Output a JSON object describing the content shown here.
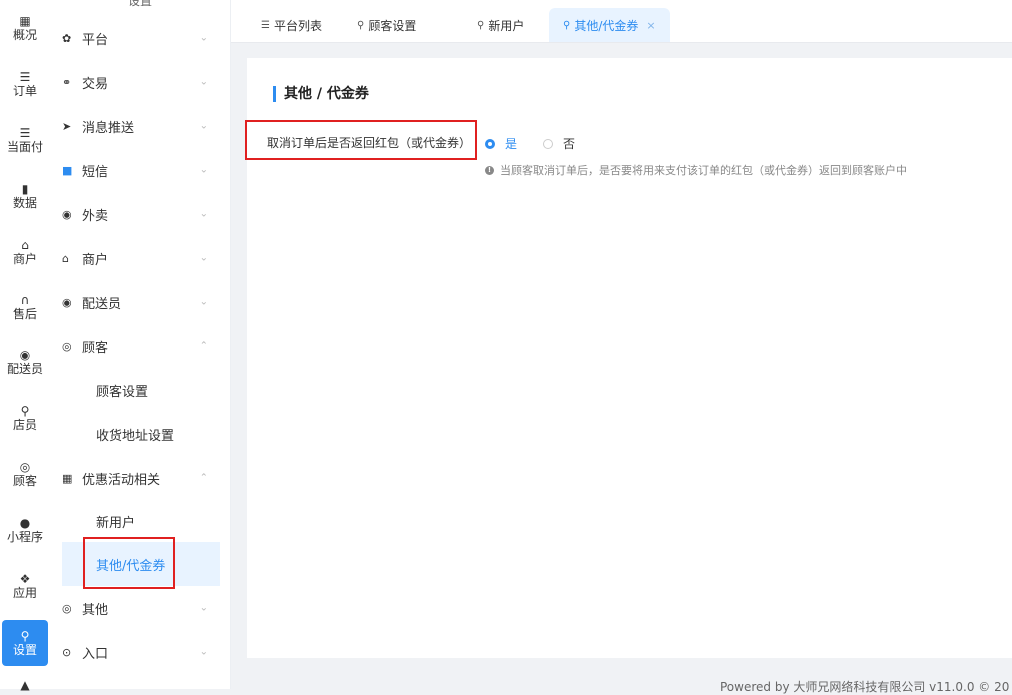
{
  "rail": {
    "items": [
      {
        "label": "概况",
        "icon": "grid-icon"
      },
      {
        "label": "订单",
        "icon": "list-icon"
      },
      {
        "label": "当面付",
        "icon": "list-icon"
      },
      {
        "label": "数据",
        "icon": "bar-chart-icon"
      },
      {
        "label": "商户",
        "icon": "store-icon"
      },
      {
        "label": "售后",
        "icon": "headset-icon"
      },
      {
        "label": "配送员",
        "icon": "scooter-icon"
      },
      {
        "label": "店员",
        "icon": "user-group-icon"
      },
      {
        "label": "顾客",
        "icon": "user-circle-icon"
      },
      {
        "label": "小程序",
        "icon": "wechat-icon"
      },
      {
        "label": "应用",
        "icon": "apps-icon"
      },
      {
        "label": "设置",
        "icon": "user-settings-icon"
      }
    ]
  },
  "sidebar": {
    "top_label": "设置",
    "menu": [
      {
        "label": "平台",
        "icon": "gear-icon"
      },
      {
        "label": "交易",
        "icon": "trade-icon"
      },
      {
        "label": "消息推送",
        "icon": "send-icon"
      },
      {
        "label": "短信",
        "icon": "sms-icon"
      },
      {
        "label": "外卖",
        "icon": "scooter-icon"
      },
      {
        "label": "商户",
        "icon": "store-icon"
      },
      {
        "label": "配送员",
        "icon": "courier-icon"
      },
      {
        "label": "顾客",
        "icon": "user-circle-icon"
      }
    ],
    "customer_sub": [
      "顾客设置",
      "收货地址设置"
    ],
    "promo": {
      "label": "优惠活动相关",
      "icon": "gift-icon"
    },
    "promo_sub": [
      "新用户",
      "其他/代金券"
    ],
    "other": {
      "label": "其他",
      "icon": "target-icon"
    },
    "entry": {
      "label": "入口",
      "icon": "entry-icon"
    }
  },
  "tabs": [
    {
      "label": "平台列表",
      "icon": "list-icon"
    },
    {
      "label": "顾客设置",
      "icon": "user-icon"
    },
    {
      "label": "新用户",
      "icon": "user-icon"
    },
    {
      "label": "其他/代金券",
      "icon": "user-icon",
      "close": "×"
    }
  ],
  "panel": {
    "title": "其他 / 代金券",
    "field_label": "取消订单后是否返回红包（或代金券）",
    "options": [
      "是",
      "否"
    ],
    "selected": "是",
    "hint": "当顾客取消订单后，是否要将用来支付该订单的红包（或代金券）返回到顾客账户中"
  },
  "footer": "Powered by 大师兄网络科技有限公司 v11.0.0 © 20"
}
